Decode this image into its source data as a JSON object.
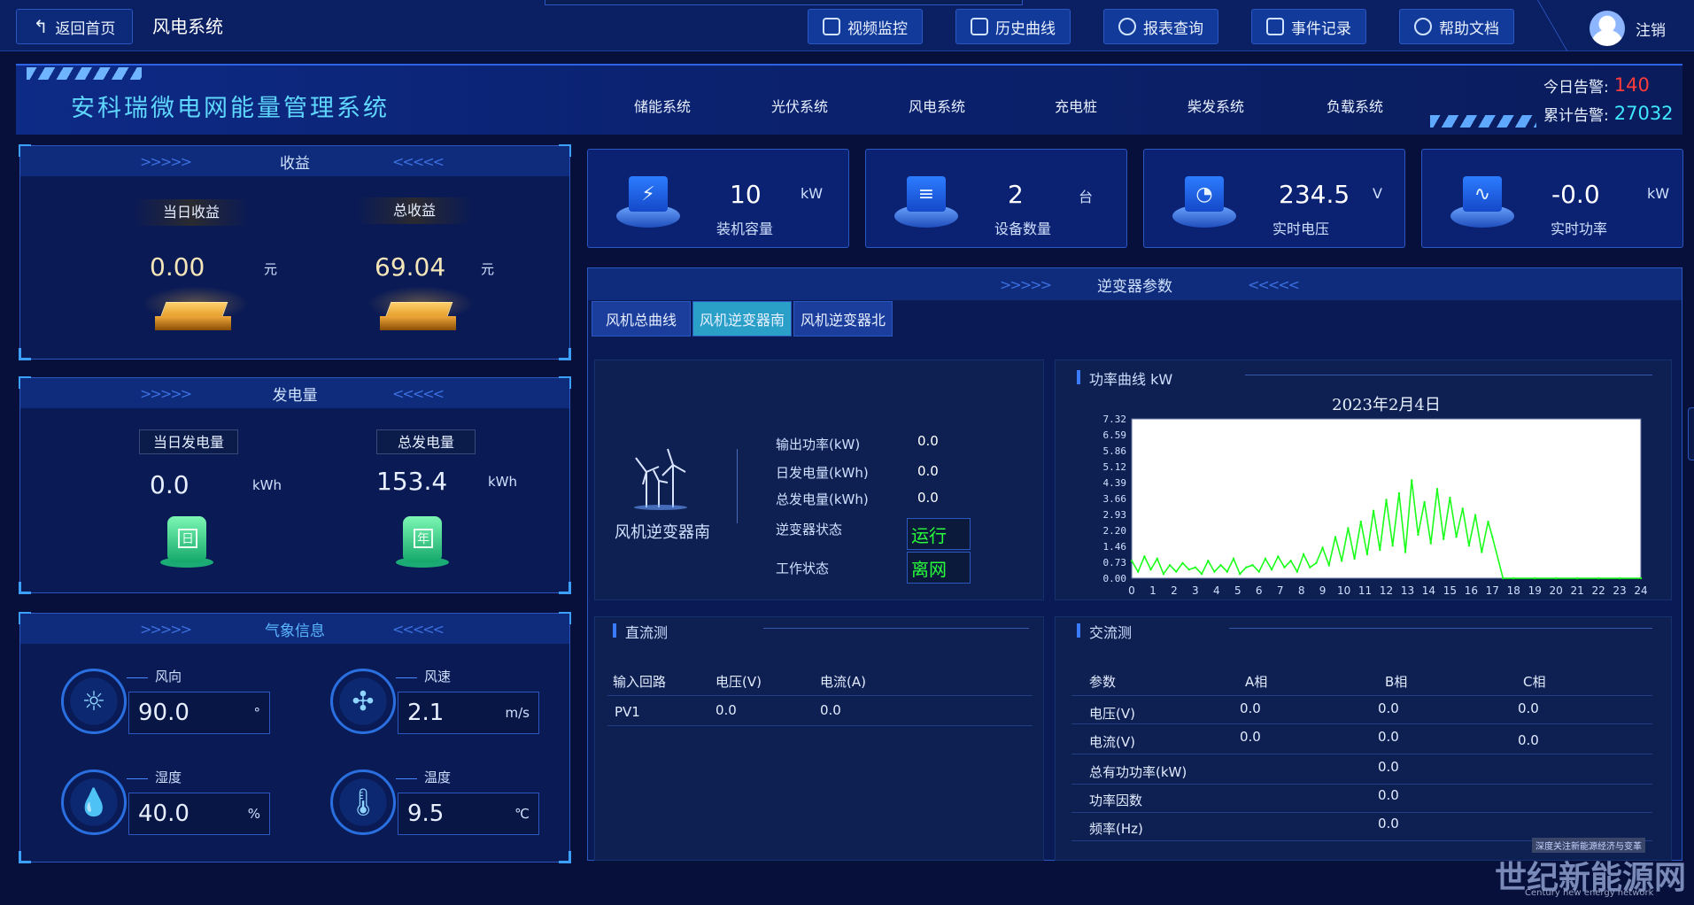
{
  "topbar": {
    "back_label": "返回首页",
    "system_title": "风电系统",
    "buttons": [
      {
        "label": "视频监控",
        "icon": "video-camera-icon"
      },
      {
        "label": "历史曲线",
        "icon": "line-chart-icon"
      },
      {
        "label": "报表查询",
        "icon": "search-report-icon"
      },
      {
        "label": "事件记录",
        "icon": "document-icon"
      },
      {
        "label": "帮助文档",
        "icon": "help-icon"
      }
    ],
    "logout_label": "注销"
  },
  "header": {
    "brand": "安科瑞微电网能量管理系统",
    "tabs": [
      "储能系统",
      "光伏系统",
      "风电系统",
      "充电桩",
      "柴发系统",
      "负载系统"
    ],
    "active_tab": "风电系统",
    "alarm_today_label": "今日告警:",
    "alarm_today_value": "140",
    "alarm_total_label": "累计告警:",
    "alarm_total_value": "27032"
  },
  "revenue": {
    "title": "收益",
    "daily_label": "当日收益",
    "daily_value": "0.00",
    "daily_unit": "元",
    "total_label": "总收益",
    "total_value": "69.04",
    "total_unit": "元"
  },
  "generation": {
    "title": "发电量",
    "daily_label": "当日发电量",
    "daily_value": "0.0",
    "daily_unit": "kWh",
    "daily_icon_text": "日",
    "total_label": "总发电量",
    "total_value": "153.4",
    "total_unit": "kWh",
    "total_icon_text": "年"
  },
  "weather": {
    "title": "气象信息",
    "items": [
      {
        "label": "风向",
        "value": "90.0",
        "unit": "°",
        "icon": "compass-sun-icon"
      },
      {
        "label": "风速",
        "value": "2.1",
        "unit": "m/s",
        "icon": "fan-icon"
      },
      {
        "label": "湿度",
        "value": "40.0",
        "unit": "%",
        "icon": "water-drop-icon"
      },
      {
        "label": "温度",
        "value": "9.5",
        "unit": "℃",
        "icon": "thermometer-icon"
      }
    ]
  },
  "stats": [
    {
      "value": "10",
      "unit": "kW",
      "label": "装机容量",
      "icon": "battery-icon"
    },
    {
      "value": "2",
      "unit": "台",
      "label": "设备数量",
      "icon": "device-icon"
    },
    {
      "value": "234.5",
      "unit": "V",
      "label": "实时电压",
      "icon": "gauge-icon"
    },
    {
      "value": "-0.0",
      "unit": "kW",
      "label": "实时功率",
      "icon": "pulse-icon"
    }
  ],
  "inverter": {
    "title": "逆变器参数",
    "tabs": [
      "风机总曲线",
      "风机逆变器南",
      "风机逆变器北"
    ],
    "active_tab": "风机逆变器南",
    "device_name": "风机逆变器南",
    "params": [
      {
        "label": "输出功率(kW)",
        "value": "0.0"
      },
      {
        "label": "日发电量(kWh)",
        "value": "0.0"
      },
      {
        "label": "总发电量(kWh)",
        "value": "0.0"
      }
    ],
    "state_label": "逆变器状态",
    "state_value": "运行",
    "work_label": "工作状态",
    "work_value": "离网"
  },
  "chart_title": "功率曲线  kW",
  "chart_data": {
    "type": "line",
    "title": "2023年2月4日",
    "xlabel": "",
    "ylabel": "",
    "xlim": [
      0,
      24
    ],
    "ylim": [
      0,
      7.32
    ],
    "y_ticks": [
      "0.00",
      "0.73",
      "1.46",
      "2.20",
      "2.93",
      "3.66",
      "4.39",
      "5.12",
      "5.86",
      "6.59",
      "7.32"
    ],
    "x_ticks": [
      "0",
      "1",
      "2",
      "3",
      "4",
      "5",
      "6",
      "7",
      "8",
      "9",
      "10",
      "11",
      "12",
      "13",
      "14",
      "15",
      "16",
      "17",
      "18",
      "19",
      "20",
      "21",
      "22",
      "23",
      "24"
    ],
    "grid": false,
    "series": [
      {
        "color": "#19ff19",
        "x": [
          0,
          0.3,
          0.6,
          0.9,
          1.2,
          1.5,
          1.8,
          2.1,
          2.4,
          2.7,
          3,
          3.3,
          3.6,
          3.9,
          4.2,
          4.5,
          4.8,
          5.1,
          5.4,
          5.7,
          6,
          6.3,
          6.6,
          6.9,
          7.2,
          7.5,
          7.8,
          8.1,
          8.4,
          8.7,
          9,
          9.3,
          9.6,
          9.9,
          10.2,
          10.5,
          10.8,
          11.1,
          11.4,
          11.7,
          12,
          12.3,
          12.6,
          12.9,
          13.2,
          13.5,
          13.8,
          14.1,
          14.4,
          14.7,
          15,
          15.3,
          15.6,
          15.9,
          16.2,
          16.5,
          16.8,
          17,
          17.5,
          18,
          19,
          20,
          21,
          22,
          23,
          24
        ],
        "values": [
          0.8,
          0.3,
          1.0,
          0.4,
          0.9,
          0.2,
          0.6,
          0.3,
          0.7,
          0.4,
          0.5,
          0.2,
          0.8,
          0.3,
          0.6,
          0.3,
          0.9,
          0.2,
          0.5,
          0.6,
          0.3,
          0.9,
          0.4,
          1.0,
          0.5,
          0.8,
          0.3,
          1.1,
          0.5,
          0.7,
          1.4,
          0.6,
          1.9,
          0.8,
          2.3,
          0.9,
          2.6,
          1.1,
          3.1,
          1.3,
          3.6,
          1.5,
          3.9,
          1.2,
          4.5,
          2.0,
          3.5,
          1.6,
          4.1,
          1.8,
          3.7,
          1.9,
          3.2,
          1.5,
          2.9,
          1.2,
          2.6,
          1.9,
          0.0,
          0.0,
          0.0,
          0.0,
          0.0,
          0.0,
          0.0,
          0.0
        ]
      }
    ]
  },
  "dc": {
    "title": "直流测",
    "headers": [
      "输入回路",
      "电压(V)",
      "电流(A)"
    ],
    "rows": [
      [
        "PV1",
        "0.0",
        "0.0"
      ]
    ]
  },
  "ac": {
    "title": "交流测",
    "headers": [
      "参数",
      "A相",
      "B相",
      "C相"
    ],
    "rows": [
      [
        "电压(V)",
        "0.0",
        "0.0",
        "0.0"
      ],
      [
        "电流(V)",
        "0.0",
        "0.0",
        "0.0"
      ],
      [
        "总有功功率(kW)",
        "",
        "0.0",
        ""
      ],
      [
        "功率因数",
        "",
        "0.0",
        ""
      ],
      [
        "频率(Hz)",
        "",
        "0.0",
        ""
      ]
    ]
  },
  "watermark": {
    "main": "世纪新能源网",
    "tagline": "深度关注新能源经济与变革",
    "en": "Century new energy network"
  }
}
